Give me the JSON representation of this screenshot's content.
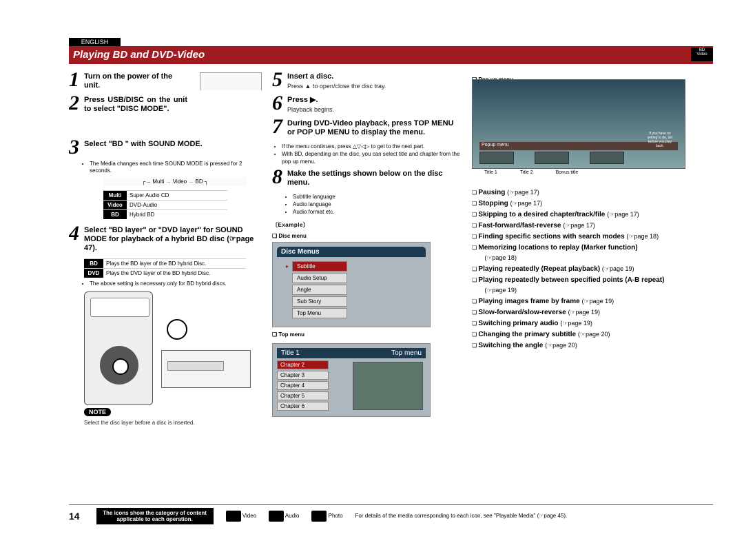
{
  "lang_tab": "ENGLISH",
  "title": "Playing BD and DVD-Video",
  "page_number": "14",
  "col1": {
    "s1_num": "1",
    "s1_text": "Turn on the power of the unit.",
    "s2_num": "2",
    "s2_text": "Press USB/DISC on the unit to select \"DISC MODE\".",
    "s3_num": "3",
    "s3_text": "Select \"BD \" with SOUND MODE.",
    "s3_note": "The Media changes each time SOUND MODE is pressed for 2 seconds.",
    "seq": "Multi → Video → BD",
    "mode_rows": [
      {
        "k": "Multi",
        "v": "Super Audio CD"
      },
      {
        "k": "Video",
        "v": "DVD-Audio"
      },
      {
        "k": "BD",
        "v": "Hybrid BD"
      }
    ],
    "s4_num": "4",
    "s4_text": "Select \"BD layer\" or \"DVD layer\" for SOUND MODE for playback of a hybrid BD disc (☞page 47).",
    "layer_rows": [
      {
        "k": "BD",
        "v": "Plays the BD layer of the BD hybrid Disc."
      },
      {
        "k": "DVD",
        "v": "Plays the DVD layer of the BD hybrid Disc."
      }
    ],
    "layer_note": "The above setting is necessary only for BD hybrid discs.",
    "note_label": "NOTE",
    "note_text": "Select the disc layer before a disc is inserted."
  },
  "col2": {
    "s5_num": "5",
    "s5_text": "Insert a disc.",
    "s5_sub": "Press ▲ to open/close the disc tray.",
    "s6_num": "6",
    "s6_text": "Press ▶.",
    "s6_sub": "Playback begins.",
    "s7_num": "7",
    "s7_text": "During DVD-Video playback, press TOP MENU or POP UP MENU to display the menu.",
    "s7_bullets": [
      "If the menu continues, press △▽◁▷ to get to the next part.",
      "With BD, depending on the disc, you can select title and chapter from the pop up menu."
    ],
    "s8_num": "8",
    "s8_text": "Make the settings shown below on the disc menu.",
    "s8_bullets": [
      "Subtitle language",
      "Audio language",
      "Audio format etc."
    ],
    "example_label": "〔Example〕",
    "discmenu_label": "❏ Disc menu",
    "discmenu_header": "Disc Menus",
    "discmenu_items": [
      "Subtitle",
      "Audio Setup",
      "Angle",
      "Sub Story",
      "Top Menu"
    ],
    "topmenu_label": "❏ Top menu",
    "topmenu_title": "Title 1",
    "topmenu_right": "Top menu",
    "chapters": [
      "Chapter 2",
      "Chapter 3",
      "Chapter 4",
      "Chapter 5",
      "Chapter 6"
    ]
  },
  "col3": {
    "popup_label": "❏ Pop up menu",
    "pop_bar": "Popup menu",
    "pop_note": "If you have no setting to do, set before you play back.",
    "thumb_titles": [
      "Title 1",
      "Title 2",
      "Bonus title"
    ],
    "refs": [
      {
        "b": "Pausing",
        "p": "(☞page 17)"
      },
      {
        "b": "Stopping",
        "p": "(☞page 17)"
      },
      {
        "b": "Skipping to a desired chapter/track/file",
        "p": "(☞page 17)"
      },
      {
        "b": "Fast-forward/fast-reverse",
        "p": "(☞page 17)"
      },
      {
        "b": "Finding specific sections with search modes",
        "p": "(☞page 18)"
      },
      {
        "b": "Memorizing locations to replay (Marker function)",
        "p": "(☞page 18)"
      },
      {
        "b": "Playing repeatedly (Repeat playback)",
        "p": "(☞page 19)"
      },
      {
        "b": "Playing repeatedly between specified points (A-B repeat)",
        "p": "(☞page 19)"
      },
      {
        "b": "Playing images frame by frame",
        "p": "(☞page 19)"
      },
      {
        "b": "Slow-forward/slow-reverse",
        "p": "(☞page 19)"
      },
      {
        "b": "Switching primary audio",
        "p": "(☞page 19)"
      },
      {
        "b": "Changing the primary subtitle",
        "p": "(☞page 20)"
      },
      {
        "b": "Switching the angle",
        "p": "(☞page 20)"
      }
    ]
  },
  "footer": {
    "callout": "The icons show the category of content applicable to each operation.",
    "cats": [
      "Video",
      "Audio",
      "Photo"
    ],
    "rightnote": "For details of the media corresponding to each icon, see \"Playable Media\" (☞page 45)."
  }
}
